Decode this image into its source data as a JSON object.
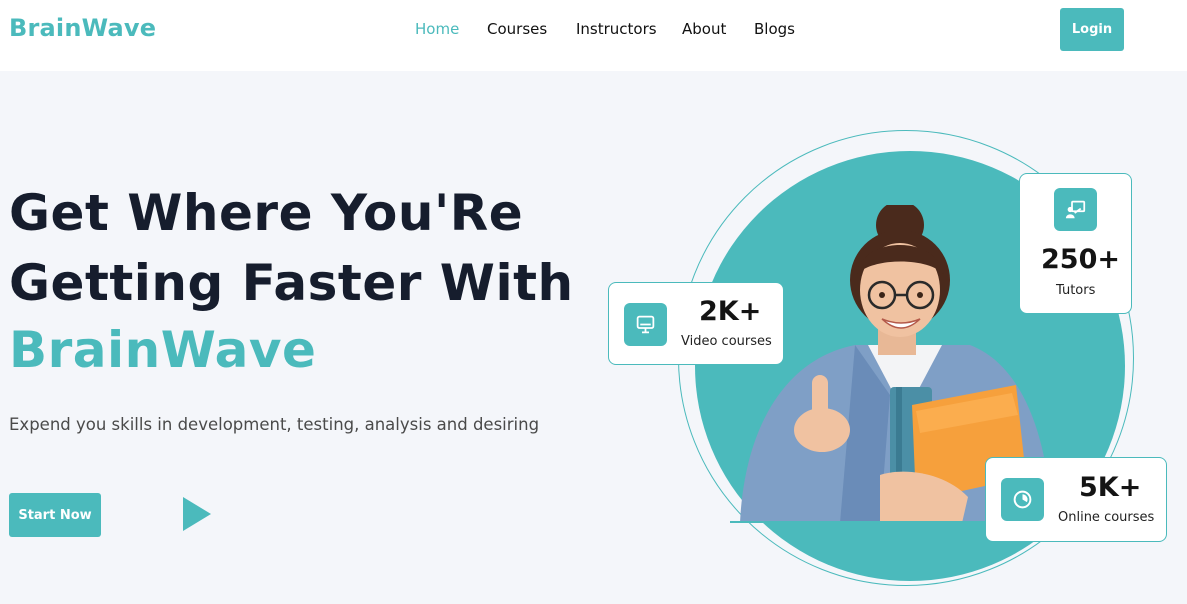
{
  "header": {
    "logo": "BrainWave",
    "nav": [
      {
        "label": "Home",
        "active": true
      },
      {
        "label": "Courses",
        "active": false
      },
      {
        "label": "Instructors",
        "active": false
      },
      {
        "label": "About",
        "active": false
      },
      {
        "label": "Blogs",
        "active": false
      }
    ],
    "login_label": "Login"
  },
  "hero": {
    "title_line1": "Get Where You'Re",
    "title_line2": "Getting Faster With",
    "brand": "BrainWave",
    "subtitle": "Expend you skills in development, testing, analysis and desiring",
    "start_label": "Start Now",
    "play_icon": "play-icon"
  },
  "stats": {
    "video": {
      "value": "2K+",
      "label": "Video courses",
      "icon": "monitor-icon"
    },
    "tutors": {
      "value": "250+",
      "label": "Tutors",
      "icon": "presentation-icon"
    },
    "online": {
      "value": "5K+",
      "label": "Online courses",
      "icon": "clock-icon"
    }
  },
  "colors": {
    "accent": "#4bbabc",
    "heading": "#161d2d",
    "background": "#f4f6fa"
  }
}
